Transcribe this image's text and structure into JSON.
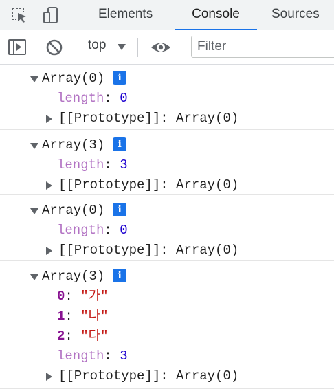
{
  "tabbar": {
    "tabs": [
      {
        "label": "Elements",
        "active": false
      },
      {
        "label": "Console",
        "active": true
      },
      {
        "label": "Sources",
        "active": false
      }
    ]
  },
  "toolbar": {
    "context": "top",
    "filter_placeholder": "Filter"
  },
  "console": {
    "groups": [
      {
        "summary": "Array(0)",
        "entries": [
          {
            "key": "length",
            "sep": ": ",
            "value": "0"
          }
        ],
        "prototype": {
          "key": "[[Prototype]]",
          "sep": ": ",
          "value": "Array(0)"
        }
      },
      {
        "summary": "Array(3)",
        "entries": [
          {
            "key": "length",
            "sep": ": ",
            "value": "3"
          }
        ],
        "prototype": {
          "key": "[[Prototype]]",
          "sep": ": ",
          "value": "Array(0)"
        }
      },
      {
        "summary": "Array(0)",
        "entries": [
          {
            "key": "length",
            "sep": ": ",
            "value": "0"
          }
        ],
        "prototype": {
          "key": "[[Prototype]]",
          "sep": ": ",
          "value": "Array(0)"
        }
      },
      {
        "summary": "Array(3)",
        "entries": [
          {
            "key": "0",
            "sep": ": ",
            "value": "\"가\""
          },
          {
            "key": "1",
            "sep": ": ",
            "value": "\"나\""
          },
          {
            "key": "2",
            "sep": ": ",
            "value": "\"다\""
          },
          {
            "key": "length",
            "sep": ": ",
            "value": "3"
          }
        ],
        "prototype": {
          "key": "[[Prototype]]",
          "sep": ": ",
          "value": "Array(0)"
        }
      }
    ],
    "info_glyph": "i"
  },
  "colors": {
    "accent": "#1a73e8",
    "number": "#1c00cf",
    "string": "#c41a16",
    "key": "#881391",
    "key_dim": "#b272c3"
  }
}
